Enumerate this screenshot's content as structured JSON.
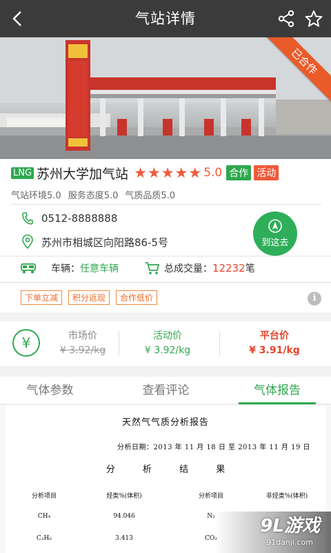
{
  "header": {
    "title": "气站详情"
  },
  "hero": {
    "ribbon_label": "已合作"
  },
  "station": {
    "fuel_badge": "LNG",
    "name": "苏州大学加气站",
    "rating": "5.0",
    "stars": 5,
    "tag_coop": "合作",
    "tag_event": "活动",
    "scores": [
      "气站环境5.0",
      "服务态度5.0",
      "气质品质5.0"
    ],
    "phone": "0512-8888888",
    "address": "苏州市相城区向阳路86-5号",
    "nav_label": "到这去",
    "vehicle_label": "车辆：",
    "vehicle_value": "任意车辆",
    "volume_label": "总成交量：",
    "volume_value": "12232",
    "volume_unit": "笔",
    "promos": [
      "下单立减",
      "积分返现",
      "合作低价"
    ]
  },
  "prices": {
    "market_label": "市场价",
    "market_value": "¥ 3.92/kg",
    "event_label": "活动价",
    "event_value": "¥ 3.92/kg",
    "platform_label": "平台价",
    "platform_value": "¥ 3.91/kg",
    "currency_symbol": "¥"
  },
  "tabs": {
    "params": "气体参数",
    "reviews": "查看评论",
    "report": "气体报告",
    "active": "report"
  },
  "report": {
    "title": "天然气气质分析报告",
    "date": "分析日期：2013 年 11 月 18 日 至 2013 年 11 月 19 日",
    "sub": [
      "分",
      "析",
      "结",
      "果"
    ],
    "headers": [
      "分析项目",
      "烃类%(体积)",
      "分析项目",
      "非烃类%(体积)"
    ],
    "rows": [
      [
        "CH₄",
        "94.046",
        "N₂",
        ""
      ],
      [
        "C₂H₆",
        "3.413",
        "CO₂",
        ""
      ]
    ]
  },
  "watermark": {
    "main": "9L游戏",
    "sub": "91danji.com"
  },
  "colors": {
    "header_bg": "#3b3b3b",
    "accent_green": "#2fa84f",
    "accent_red": "#e8452a",
    "ribbon": "#ea5b2a"
  }
}
